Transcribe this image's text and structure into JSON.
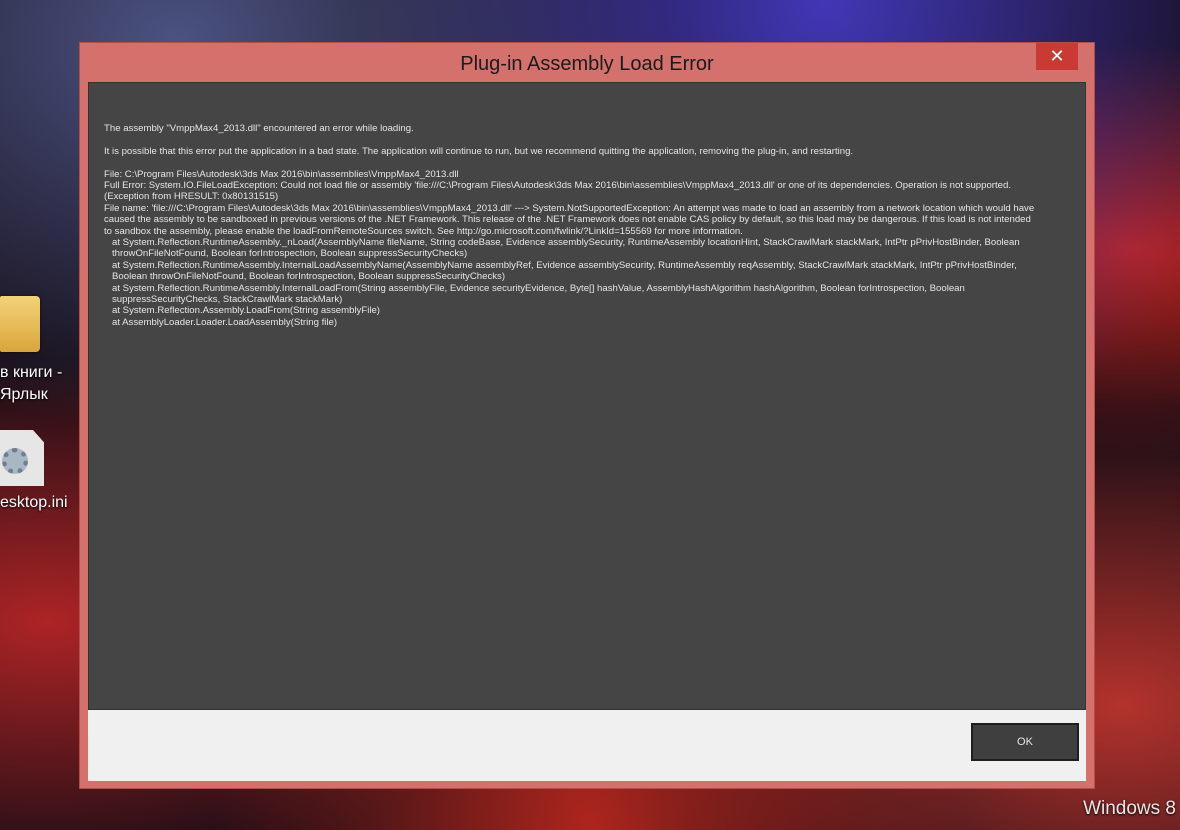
{
  "desktop": {
    "icon1_label_line1": "в книги -",
    "icon1_label_line2": "Ярлык",
    "icon2_label": "esktop.ini",
    "os_label": "Windows 8"
  },
  "dialog": {
    "title": "Plug-in Assembly Load Error",
    "close_glyph": "✕",
    "ok_label": "OK",
    "lines": [
      "The assembly \"VmppMax4_2013.dll\" encountered an error while loading.",
      "",
      "It is possible that this error put the application in a bad state. The application will continue to run, but we recommend quitting the application, removing the plug-in, and restarting.",
      "",
      "File: C:\\Program Files\\Autodesk\\3ds Max 2016\\bin\\assemblies\\VmppMax4_2013.dll",
      "Full Error: System.IO.FileLoadException: Could not load file or assembly 'file:///C:\\Program Files\\Autodesk\\3ds Max 2016\\bin\\assemblies\\VmppMax4_2013.dll' or one of its dependencies. Operation is not supported. (Exception from HRESULT: 0x80131515)",
      "File name: 'file:///C:\\Program Files\\Autodesk\\3ds Max 2016\\bin\\assemblies\\VmppMax4_2013.dll' ---> System.NotSupportedException: An attempt was made to load an assembly from a network location which would have caused the assembly to be sandboxed in previous versions of the .NET Framework. This release of the .NET Framework does not enable CAS policy by default, so this load may be dangerous. If this load is not intended to sandbox the assembly, please enable the loadFromRemoteSources switch. See http://go.microsoft.com/fwlink/?LinkId=155569 for more information.",
      "at System.Reflection.RuntimeAssembly._nLoad(AssemblyName fileName, String codeBase, Evidence assemblySecurity, RuntimeAssembly locationHint, StackCrawlMark stackMark, IntPtr pPrivHostBinder, Boolean throwOnFileNotFound, Boolean forIntrospection, Boolean suppressSecurityChecks)",
      "at System.Reflection.RuntimeAssembly.InternalLoadAssemblyName(AssemblyName assemblyRef, Evidence assemblySecurity, RuntimeAssembly reqAssembly, StackCrawlMark stackMark, IntPtr pPrivHostBinder, Boolean throwOnFileNotFound, Boolean forIntrospection, Boolean suppressSecurityChecks)",
      "at System.Reflection.RuntimeAssembly.InternalLoadFrom(String assemblyFile, Evidence securityEvidence, Byte[] hashValue, AssemblyHashAlgorithm hashAlgorithm, Boolean forIntrospection, Boolean suppressSecurityChecks, StackCrawlMark stackMark)",
      "at System.Reflection.Assembly.LoadFrom(String assemblyFile)",
      "at AssemblyLoader.Loader.LoadAssembly(String file)"
    ]
  }
}
